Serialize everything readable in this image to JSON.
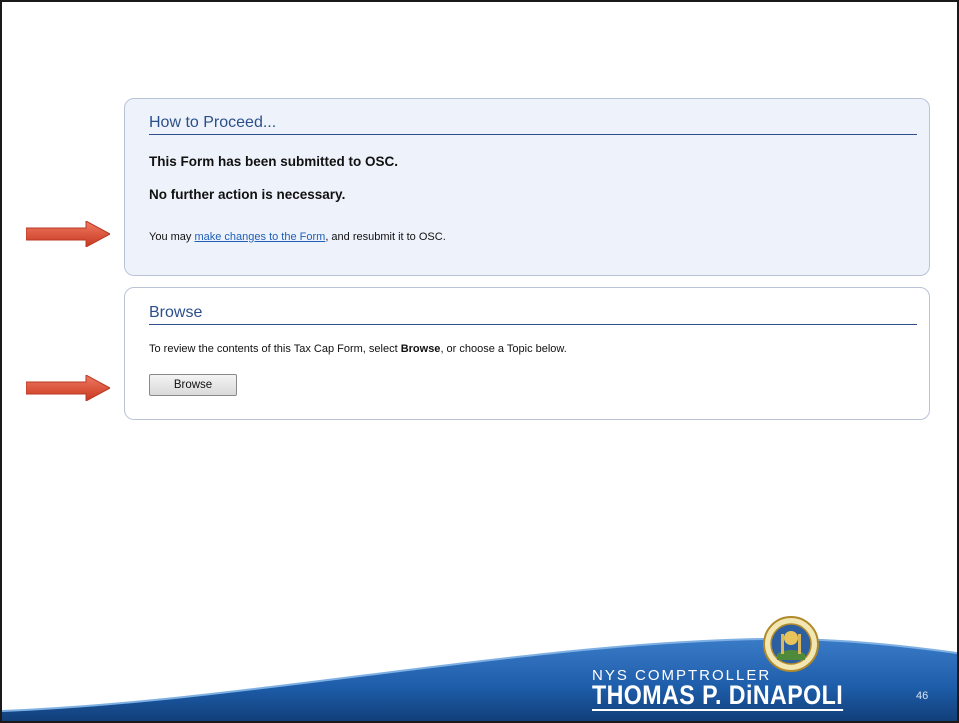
{
  "proceed": {
    "title": "How to Proceed...",
    "line1": "This Form has been submitted to OSC.",
    "line2": "No further action is necessary.",
    "line3_prefix": "You may ",
    "line3_link": "make changes to the Form",
    "line3_suffix": ", and resubmit it to OSC."
  },
  "browse": {
    "title": "Browse",
    "text_prefix": "To review the contents of this Tax Cap Form, select ",
    "text_bold": "Browse",
    "text_suffix": ", or choose a Topic below.",
    "button_label": "Browse"
  },
  "footer": {
    "kicker": "NYS COMPTROLLER",
    "name": "THOMAS P. DiNAPOLI",
    "slide_number": "46"
  },
  "colors": {
    "accent": "#2b4f8a",
    "arrow": "#e0533f",
    "footer_blue": "#1d5ca8"
  },
  "icons": {
    "arrow": "right-arrow-icon",
    "seal": "state-seal-icon"
  }
}
